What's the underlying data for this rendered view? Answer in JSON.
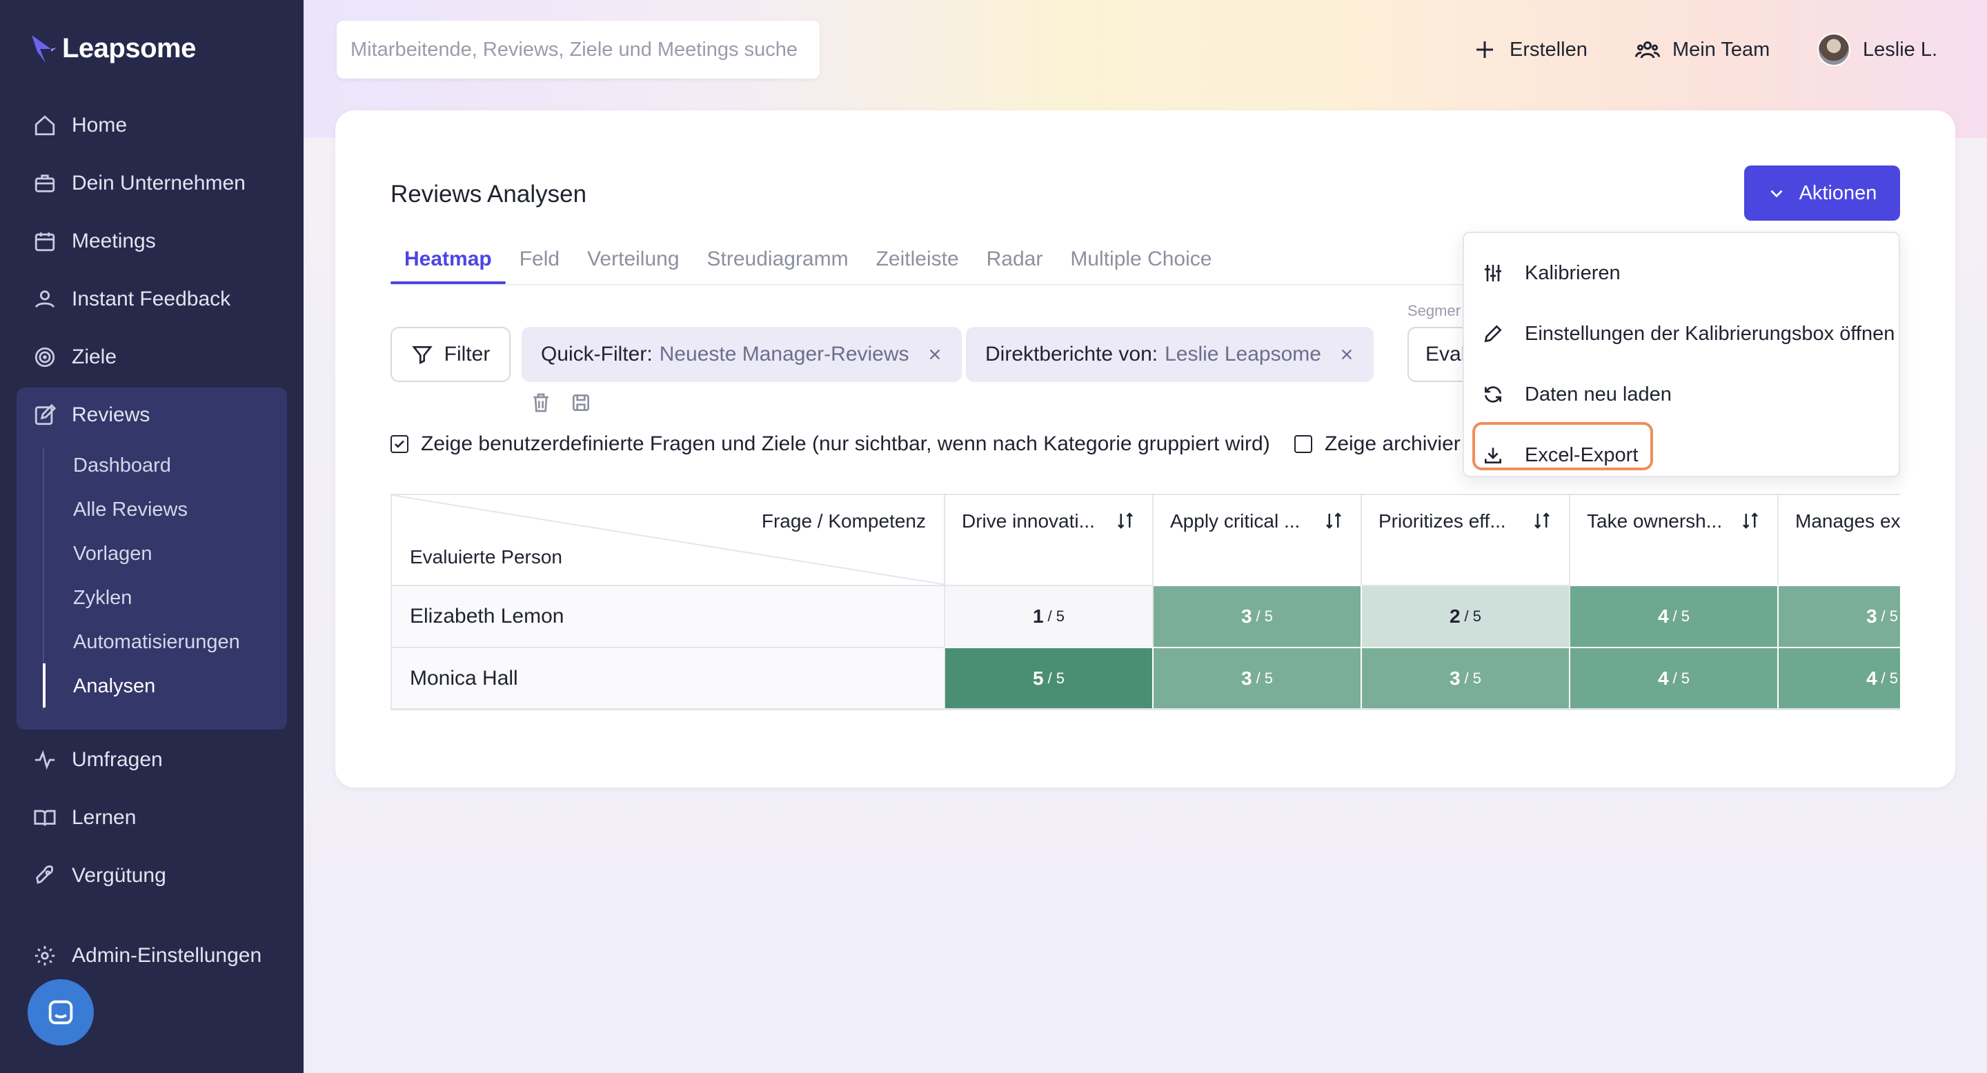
{
  "app": {
    "name": "Leapsome"
  },
  "sidebar": {
    "items": [
      {
        "label": "Home",
        "icon": "home-icon"
      },
      {
        "label": "Dein Unternehmen",
        "icon": "briefcase-icon"
      },
      {
        "label": "Meetings",
        "icon": "calendar-icon"
      },
      {
        "label": "Instant Feedback",
        "icon": "feedback-icon"
      },
      {
        "label": "Ziele",
        "icon": "target-icon"
      },
      {
        "label": "Reviews",
        "icon": "edit-icon"
      },
      {
        "label": "Umfragen",
        "icon": "pulse-icon"
      },
      {
        "label": "Lernen",
        "icon": "book-icon"
      },
      {
        "label": "Vergütung",
        "icon": "rocket-icon"
      },
      {
        "label": "Admin-Einstellungen",
        "icon": "gear-icon"
      }
    ],
    "reviews_sub": [
      "Dashboard",
      "Alle Reviews",
      "Vorlagen",
      "Zyklen",
      "Automatisierungen",
      "Analysen"
    ],
    "active_sub": "Analysen"
  },
  "header": {
    "search_placeholder": "Mitarbeitende, Reviews, Ziele und Meetings suche",
    "create_label": "Erstellen",
    "team_label": "Mein Team",
    "user_label": "Leslie L."
  },
  "page": {
    "title": "Reviews Analysen",
    "actions_label": "Aktionen",
    "tabs": [
      "Heatmap",
      "Feld",
      "Verteilung",
      "Streudiagramm",
      "Zeitleiste",
      "Radar",
      "Multiple Choice"
    ],
    "active_tab": "Heatmap",
    "filter_label": "Filter",
    "chips": [
      {
        "key": "Quick-Filter:",
        "value": "Neueste Manager-Reviews"
      },
      {
        "key": "Direktberichte von:",
        "value": "Leslie Leapsome"
      }
    ],
    "segment_label": "Segmer",
    "segment_value": "Eval",
    "checkbox_custom": "Zeige benutzerdefinierte Fragen und Ziele (nur sichtbar, wenn nach Kategorie gruppiert wird)",
    "checkbox_archived": "Zeige archivier"
  },
  "dropdown": {
    "items": [
      {
        "label": "Kalibrieren",
        "icon": "sliders-icon"
      },
      {
        "label": "Einstellungen der Kalibrierungsbox öffnen",
        "icon": "pencil-icon"
      },
      {
        "label": "Daten neu laden",
        "icon": "refresh-icon"
      },
      {
        "label": "Excel-Export",
        "icon": "download-icon"
      }
    ]
  },
  "table": {
    "corner_top": "Frage / Kompetenz",
    "corner_bottom": "Evaluierte Person",
    "columns": [
      "Drive innovati...",
      "Apply critical ...",
      "Prioritizes eff...",
      "Take ownersh...",
      "Manages ex"
    ],
    "rows": [
      {
        "name": "Elizabeth Lemon",
        "scores": [
          1,
          3,
          2,
          4,
          3
        ]
      },
      {
        "name": "Monica Hall",
        "scores": [
          5,
          3,
          3,
          4,
          4
        ]
      }
    ],
    "denominator": "/ 5"
  },
  "colors": {
    "accent": "#4b46e0",
    "sidebar": "#26294a",
    "heat": {
      "1": "#f7f7f9",
      "2": "#cfe0da",
      "3": "#7aae98",
      "4": "#6fa891",
      "5": "#4a8f74"
    },
    "highlight": "#ef8e5a"
  }
}
